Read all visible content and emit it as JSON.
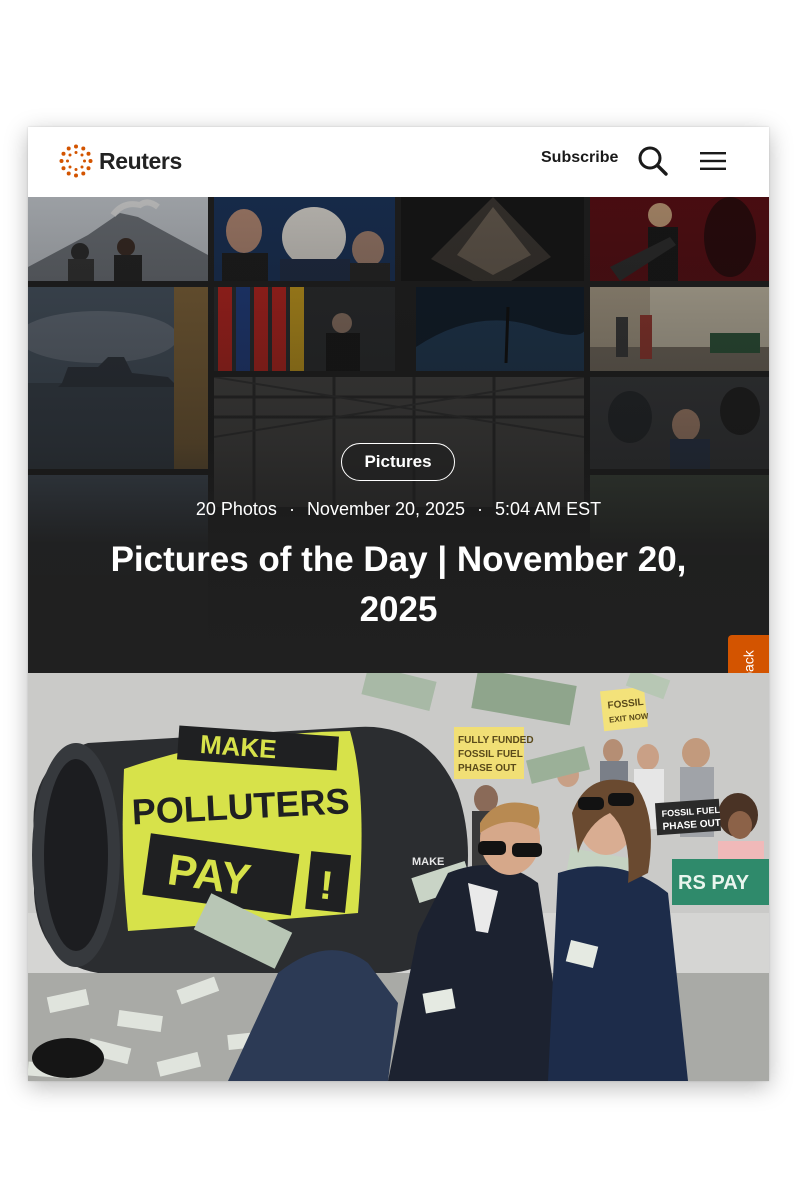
{
  "header": {
    "brand": "Reuters",
    "subscribe_label": "Subscribe"
  },
  "hero": {
    "category": "Pictures",
    "photo_count": "20 Photos",
    "date": "November 20, 2025",
    "time": "5:04 AM EST",
    "title": "Pictures of the Day | November 20, 2025"
  },
  "feedback": {
    "label": "Feedback"
  },
  "lead_photo": {
    "barrel_text": [
      "MAKE",
      "POLLUTERS",
      "PAY",
      "!"
    ],
    "signs": [
      "FOSSIL EXIT NOW",
      "FULLY FUNDED FOSSIL FUEL PHASE OUT",
      "FOSSIL FUEL PHASE OUT",
      "MAKE",
      "RS PAY"
    ]
  },
  "colors": {
    "brand_orange": "#d35400",
    "hero_background": "#1f1f1f",
    "barrel_yellow": "#d7e24a",
    "barrel_dark": "#2b2d30"
  },
  "icons": {
    "logo": "reuters-logo-icon",
    "search": "search-icon",
    "menu": "hamburger-menu-icon"
  }
}
